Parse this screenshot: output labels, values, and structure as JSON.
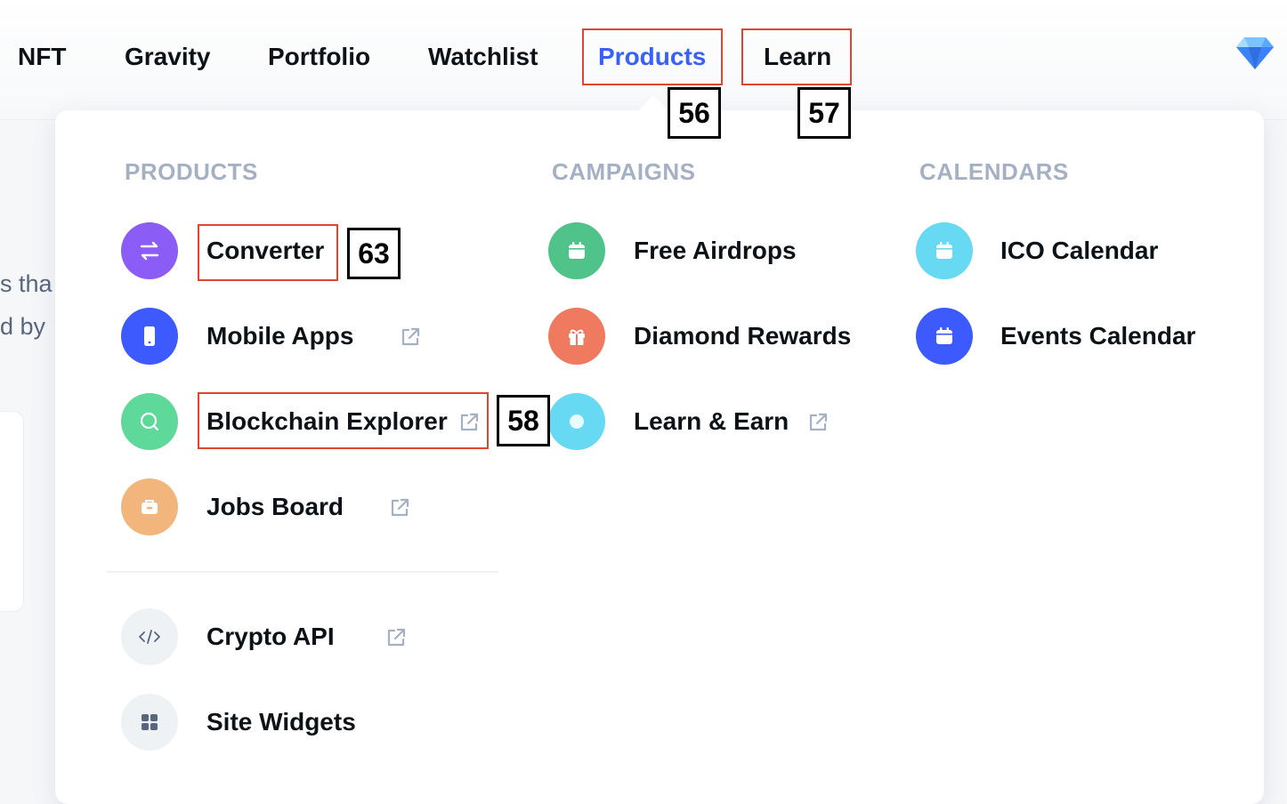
{
  "nav": {
    "items": [
      {
        "label": "NFT"
      },
      {
        "label": "Gravity"
      },
      {
        "label": "Portfolio"
      },
      {
        "label": "Watchlist"
      },
      {
        "label": "Products"
      },
      {
        "label": "Learn"
      }
    ],
    "diamond_icon": "diamond-icon"
  },
  "background": {
    "text_line1": "s tha",
    "text_line2": "d by"
  },
  "dropdown": {
    "products": {
      "title": "PRODUCTS",
      "items": [
        {
          "label": "Converter",
          "icon": "swap-arrows-icon",
          "color": "#8b5cf6",
          "external": false
        },
        {
          "label": "Mobile Apps",
          "icon": "phone-icon",
          "color": "#3d5afe",
          "external": true
        },
        {
          "label": "Blockchain Explorer",
          "icon": "search-icon",
          "color": "#5fd99a",
          "external": true
        },
        {
          "label": "Jobs Board",
          "icon": "briefcase-icon",
          "color": "#f2b57c",
          "external": true
        }
      ],
      "extra_items": [
        {
          "label": "Crypto API",
          "icon": "code-icon",
          "color": "#eff2f5",
          "external": true
        },
        {
          "label": "Site Widgets",
          "icon": "grid-icon",
          "color": "#eff2f5",
          "external": false
        }
      ]
    },
    "campaigns": {
      "title": "CAMPAIGNS",
      "items": [
        {
          "label": "Free Airdrops",
          "icon": "calendar-icon",
          "color": "#4fc38a",
          "external": false
        },
        {
          "label": "Diamond Rewards",
          "icon": "gift-icon",
          "color": "#f07a5f",
          "external": false
        },
        {
          "label": "Learn & Earn",
          "icon": "coin-icon",
          "color": "#67d9f2",
          "external": true
        }
      ]
    },
    "calendars": {
      "title": "CALENDARS",
      "items": [
        {
          "label": "ICO Calendar",
          "icon": "calendar-icon",
          "color": "#67d9f2",
          "external": false
        },
        {
          "label": "Events Calendar",
          "icon": "calendar-icon",
          "color": "#3d5afe",
          "external": false
        }
      ]
    }
  },
  "annotations": {
    "products_tag": "56",
    "learn_tag": "57",
    "converter_tag": "63",
    "explorer_tag": "58"
  }
}
